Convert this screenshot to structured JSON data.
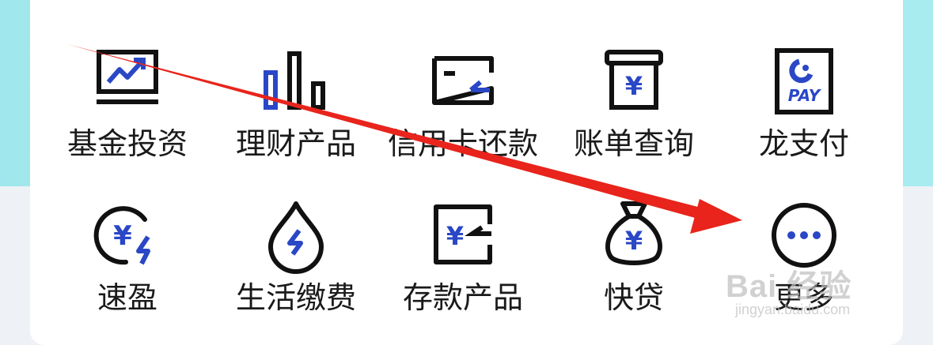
{
  "colors": {
    "icon_dark": "#111111",
    "accent": "#2a47c6",
    "annotation": "#e8241c"
  },
  "grid": {
    "row1": [
      {
        "label": "基金投资",
        "icon": "fund-chart-icon"
      },
      {
        "label": "理财产品",
        "icon": "bar-chart-icon"
      },
      {
        "label": "信用卡还款",
        "icon": "credit-card-icon"
      },
      {
        "label": "账单查询",
        "icon": "bill-box-icon"
      },
      {
        "label": "龙支付",
        "icon": "loong-pay-icon",
        "icon_text": "PAY"
      }
    ],
    "row2": [
      {
        "label": "速盈",
        "icon": "yen-fast-icon",
        "icon_text": "¥"
      },
      {
        "label": "生活缴费",
        "icon": "drop-bolt-icon"
      },
      {
        "label": "存款产品",
        "icon": "deposit-icon",
        "icon_text": "¥"
      },
      {
        "label": "快贷",
        "icon": "money-bag-icon",
        "icon_text": "¥"
      },
      {
        "label": "更多",
        "icon": "more-icon"
      }
    ]
  },
  "watermark": {
    "main": "Bai 经验",
    "sub": "jingyan.baidu.com"
  }
}
